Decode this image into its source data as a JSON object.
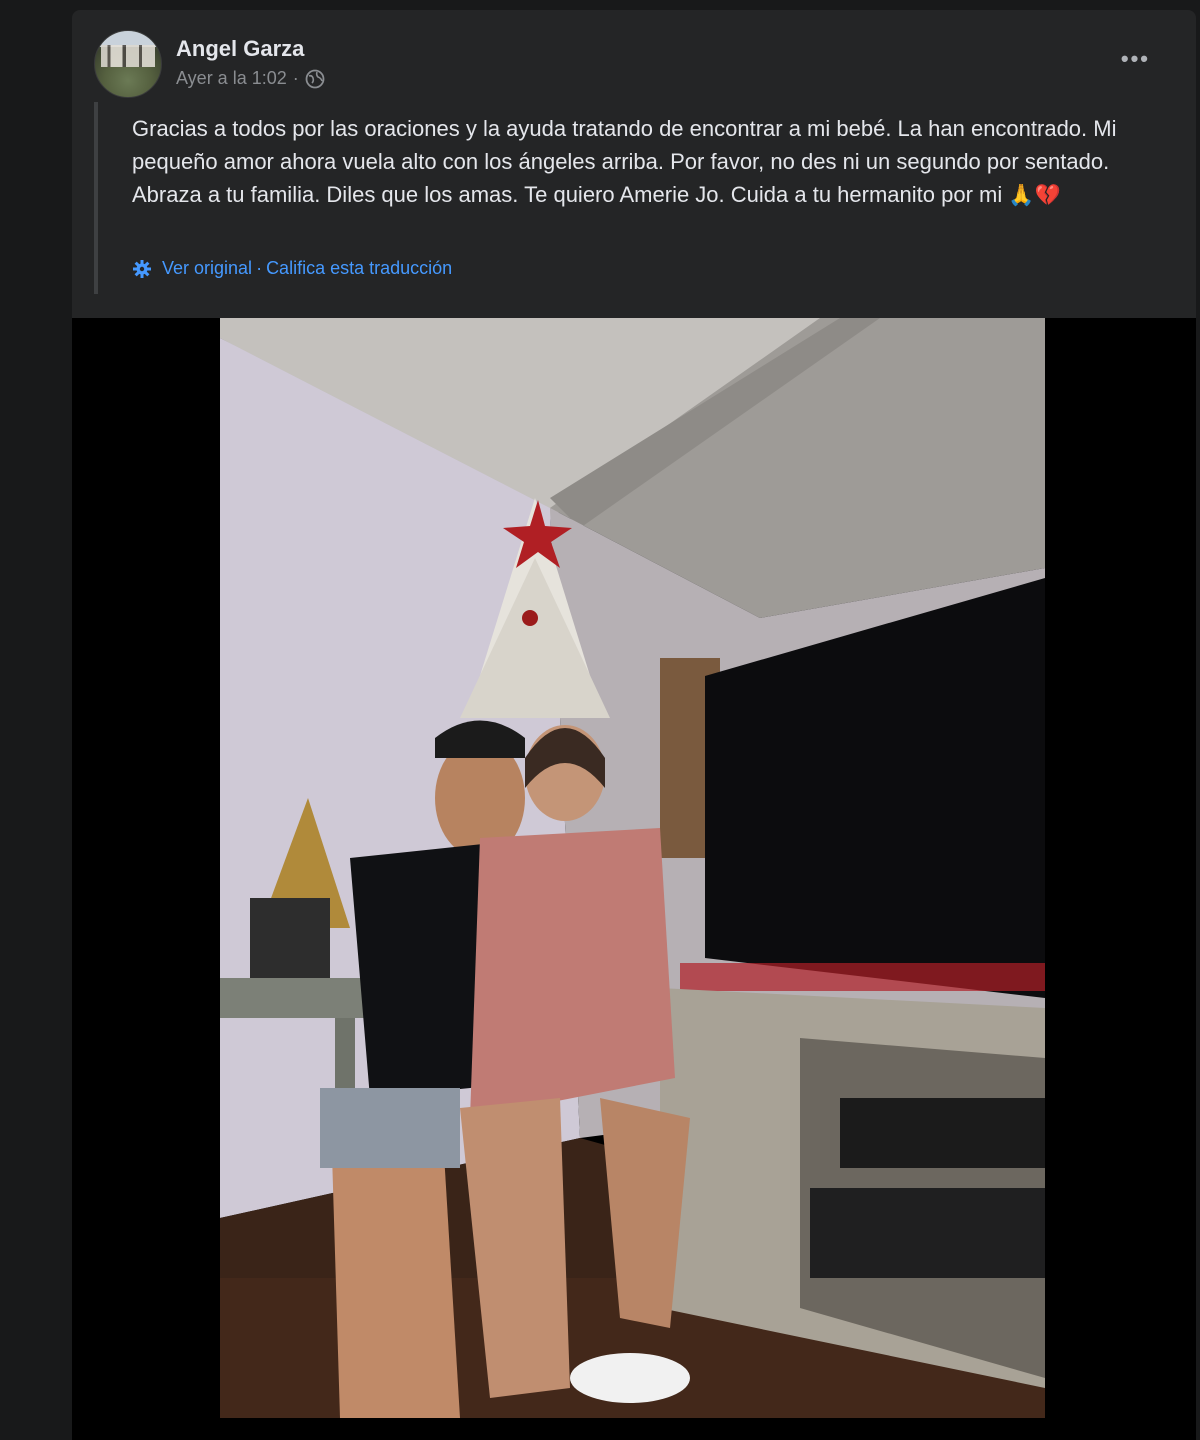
{
  "post": {
    "author": "Angel Garza",
    "timestamp": "Ayer a la 1:02",
    "separator": "·",
    "privacy_icon": "globe-icon",
    "more_label": "•••",
    "text_line1": "Gracias a todos por las oraciones y la ayuda tratando de encontrar a mi bebé. La han encontrado. Mi pequeño amor ahora vuela alto con los ángeles arriba. Por favor, no des ni un segundo por sentado. Abraza a tu familia. Diles que los amas. Te quiero Amerie Jo. Cuida a tu hermanito por mi",
    "emoji_pray": "🙏",
    "emoji_heart": "💔",
    "translation": {
      "view_original": "Ver original",
      "dot": "·",
      "rate": "Califica esta traducción"
    }
  },
  "colors": {
    "page_bg": "#18191a",
    "card_bg": "#242526",
    "text_primary": "#e4e6eb",
    "text_secondary": "#8a8d91",
    "link": "#4599ff"
  }
}
